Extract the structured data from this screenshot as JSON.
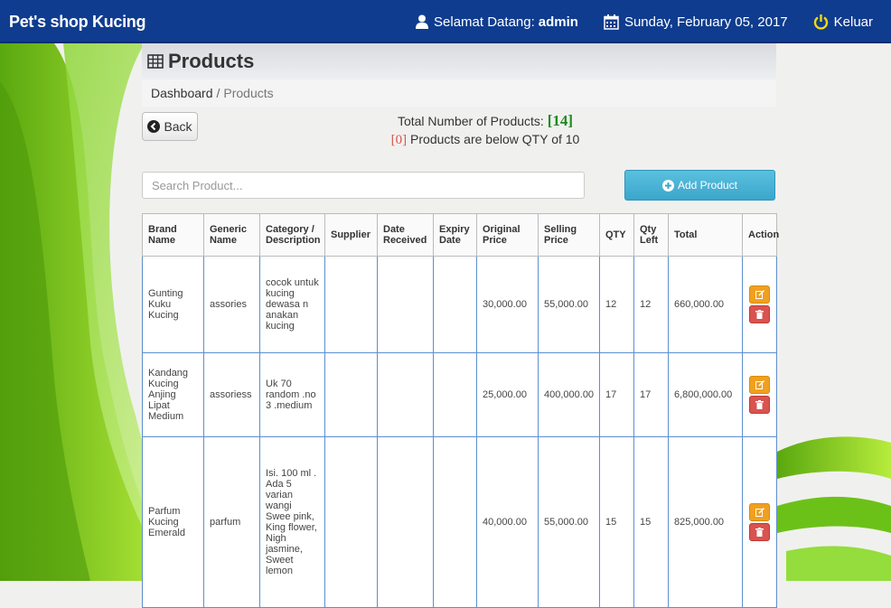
{
  "navbar": {
    "brand": "Pet's shop Kucing",
    "welcome_prefix": "Selamat Datang:",
    "username": "admin",
    "date": "Sunday, February 05, 2017",
    "logout_label": "Keluar"
  },
  "page": {
    "title": "Products",
    "breadcrumb": [
      "Dashboard",
      "Products"
    ],
    "back_label": "Back",
    "totals_prefix": "Total Number of Products:",
    "total_count": "[14]",
    "below_count": "[0]",
    "below_text": "Products are below QTY of 10"
  },
  "search": {
    "placeholder": "Search Product..."
  },
  "add_button_label": "Add Product",
  "table": {
    "headers": [
      "Brand Name",
      "Generic Name",
      "Category / Description",
      "Supplier",
      "Date Received",
      "Expiry Date",
      "Original Price",
      "Selling Price",
      "QTY",
      "Qty Left",
      "Total",
      "Action"
    ],
    "rows": [
      {
        "brand": "Gunting Kuku Kucing",
        "generic": "assories",
        "desc": "cocok untuk kucing dewasa n anakan kucing",
        "supplier": "",
        "received": "",
        "expiry": "",
        "orig": "30,000.00",
        "sell": "55,000.00",
        "qty": "12",
        "left": "12",
        "total": "660,000.00"
      },
      {
        "brand": "Kandang Kucing Anjing Lipat Medium",
        "generic": "assoriess",
        "desc": "Uk 70 random .no 3 .medium",
        "supplier": "",
        "received": "",
        "expiry": "",
        "orig": "25,000.00",
        "sell": "400,000.00",
        "qty": "17",
        "left": "17",
        "total": "6,800,000.00"
      },
      {
        "brand": "Parfum Kucing Emerald",
        "generic": "parfum",
        "desc": "Isi. 100 ml . Ada 5 varian wangi Swee pink, King flower, Nigh jasmine, Sweet lemon",
        "supplier": "",
        "received": "",
        "expiry": "",
        "orig": "40,000.00",
        "sell": "55,000.00",
        "qty": "15",
        "left": "15",
        "total": "825,000.00"
      }
    ]
  },
  "colors": {
    "navbar": "#0f3c8e",
    "info_button": "#5bc0de",
    "edit": "#f0a020",
    "delete": "#d9534f",
    "green_swirl": "#7ed321"
  }
}
